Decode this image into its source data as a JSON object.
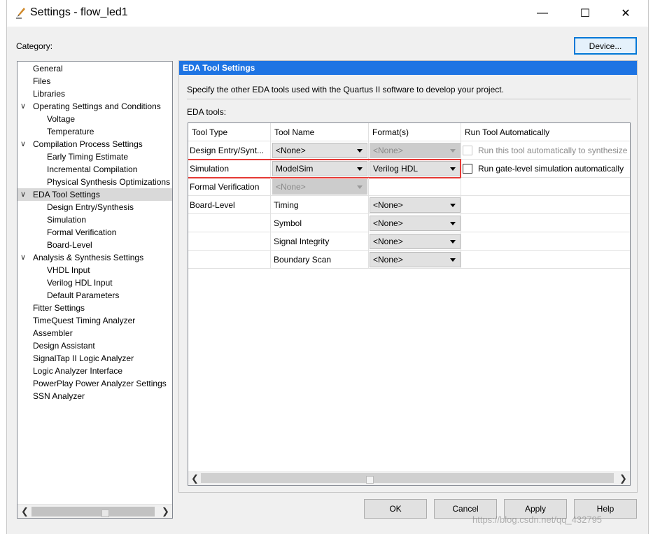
{
  "window": {
    "title": "Settings - flow_led1",
    "minimize_glyph": "—",
    "maximize_glyph": "☐",
    "close_glyph": "✕"
  },
  "category_label": "Category:",
  "device_button": "Device...",
  "tree": [
    {
      "label": "General",
      "level": 0,
      "expandable": false
    },
    {
      "label": "Files",
      "level": 0,
      "expandable": false
    },
    {
      "label": "Libraries",
      "level": 0,
      "expandable": false
    },
    {
      "label": "Operating Settings and Conditions",
      "level": 0,
      "expandable": true
    },
    {
      "label": "Voltage",
      "level": 1,
      "expandable": false
    },
    {
      "label": "Temperature",
      "level": 1,
      "expandable": false
    },
    {
      "label": "Compilation Process Settings",
      "level": 0,
      "expandable": true
    },
    {
      "label": "Early Timing Estimate",
      "level": 1,
      "expandable": false
    },
    {
      "label": "Incremental Compilation",
      "level": 1,
      "expandable": false
    },
    {
      "label": "Physical Synthesis Optimizations",
      "level": 1,
      "expandable": false
    },
    {
      "label": "EDA Tool Settings",
      "level": 0,
      "expandable": true,
      "selected": true
    },
    {
      "label": "Design Entry/Synthesis",
      "level": 1,
      "expandable": false
    },
    {
      "label": "Simulation",
      "level": 1,
      "expandable": false
    },
    {
      "label": "Formal Verification",
      "level": 1,
      "expandable": false
    },
    {
      "label": "Board-Level",
      "level": 1,
      "expandable": false
    },
    {
      "label": "Analysis & Synthesis Settings",
      "level": 0,
      "expandable": true
    },
    {
      "label": "VHDL Input",
      "level": 1,
      "expandable": false
    },
    {
      "label": "Verilog HDL Input",
      "level": 1,
      "expandable": false
    },
    {
      "label": "Default Parameters",
      "level": 1,
      "expandable": false
    },
    {
      "label": "Fitter Settings",
      "level": 0,
      "expandable": false
    },
    {
      "label": "TimeQuest Timing Analyzer",
      "level": 0,
      "expandable": false
    },
    {
      "label": "Assembler",
      "level": 0,
      "expandable": false
    },
    {
      "label": "Design Assistant",
      "level": 0,
      "expandable": false
    },
    {
      "label": "SignalTap II Logic Analyzer",
      "level": 0,
      "expandable": false
    },
    {
      "label": "Logic Analyzer Interface",
      "level": 0,
      "expandable": false
    },
    {
      "label": "PowerPlay Power Analyzer Settings",
      "level": 0,
      "expandable": false
    },
    {
      "label": "SSN Analyzer",
      "level": 0,
      "expandable": false
    }
  ],
  "pane": {
    "header": "EDA Tool Settings",
    "description": "Specify the other EDA tools used with the Quartus II software to develop your project.",
    "eda_tools_label": "EDA tools:",
    "columns": [
      "Tool Type",
      "Tool Name",
      "Format(s)",
      "Run Tool Automatically"
    ],
    "rows": [
      {
        "tool_type": "Design Entry/Synt...",
        "tool_name": "<None>",
        "tool_name_kind": "combo",
        "format": "<None>",
        "format_kind": "combo-disabled",
        "run": "Run this tool automatically to synthesize",
        "run_kind": "check-disabled"
      },
      {
        "tool_type": "Simulation",
        "tool_name": "ModelSim",
        "tool_name_kind": "combo",
        "format": "Verilog HDL",
        "format_kind": "combo",
        "run": "Run gate-level simulation automatically",
        "run_kind": "check"
      },
      {
        "tool_type": "Formal Verification",
        "tool_name": "<None>",
        "tool_name_kind": "combo-disabled",
        "format": "",
        "format_kind": "none",
        "run": "",
        "run_kind": "none"
      },
      {
        "tool_type": "Board-Level",
        "tool_name": "Timing",
        "tool_name_kind": "text",
        "format": "<None>",
        "format_kind": "combo",
        "run": "",
        "run_kind": "none"
      },
      {
        "tool_type": "",
        "tool_name": "Symbol",
        "tool_name_kind": "text",
        "format": "<None>",
        "format_kind": "combo",
        "run": "",
        "run_kind": "none"
      },
      {
        "tool_type": "",
        "tool_name": "Signal Integrity",
        "tool_name_kind": "text",
        "format": "<None>",
        "format_kind": "combo",
        "run": "",
        "run_kind": "none"
      },
      {
        "tool_type": "",
        "tool_name": "Boundary Scan",
        "tool_name_kind": "text",
        "format": "<None>",
        "format_kind": "combo",
        "run": "",
        "run_kind": "none"
      }
    ]
  },
  "buttons": {
    "ok": "OK",
    "cancel": "Cancel",
    "apply": "Apply",
    "help": "Help"
  },
  "watermark": "https://blog.csdn.net/qq_432795"
}
